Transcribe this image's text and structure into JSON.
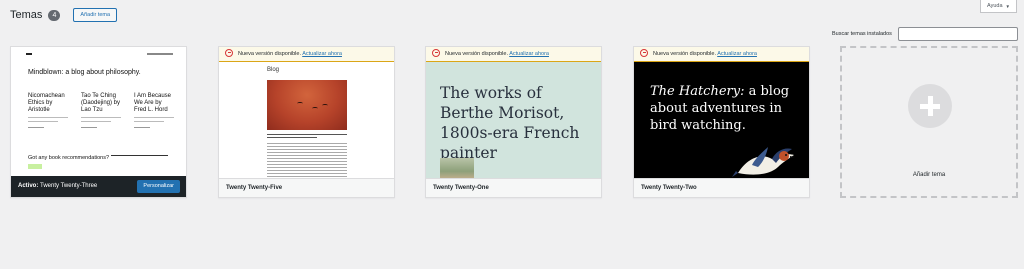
{
  "header": {
    "title": "Temas",
    "count": "4",
    "add_button": "Añadir tema"
  },
  "help": {
    "label": "Ayuda"
  },
  "search": {
    "label": "Buscar temas instalados",
    "value": ""
  },
  "themes": [
    {
      "active_prefix": "Activo:",
      "name": "Twenty Twenty-Three",
      "customize_button": "Personalizar",
      "preview": {
        "tagline": "Mindblown: a blog about philosophy.",
        "posts": [
          "Nicomachean Ethics by Aristotle",
          "Tao Te Ching (Daodejing) by Lao Tzu",
          "I Am Because We Are by Fred L. Hord"
        ],
        "footer_prompt": "Got any book recommendations?"
      }
    },
    {
      "name": "Twenty Twenty-Five",
      "notice_text": "Nueva versión disponible.",
      "notice_link": "Actualizar ahora",
      "preview": {
        "heading": "Blog"
      }
    },
    {
      "name": "Twenty Twenty-One",
      "notice_text": "Nueva versión disponible.",
      "notice_link": "Actualizar ahora",
      "preview": {
        "hero": "The works of Berthe Morisot, 1800s-era French painter"
      }
    },
    {
      "name": "Twenty Twenty-Two",
      "notice_text": "Nueva versión disponible.",
      "notice_link": "Actualizar ahora",
      "preview": {
        "hero_italic": "The Hatchery:",
        "hero_rest": " a blog about adventures in bird watching."
      }
    }
  ],
  "add_card": {
    "label": "Añadir tema"
  },
  "colors": {
    "primary": "#2271b1",
    "notice_bg": "#fcf9e8",
    "notice_border": "#dba617",
    "error": "#d63638",
    "active_bar": "#1d2327"
  }
}
